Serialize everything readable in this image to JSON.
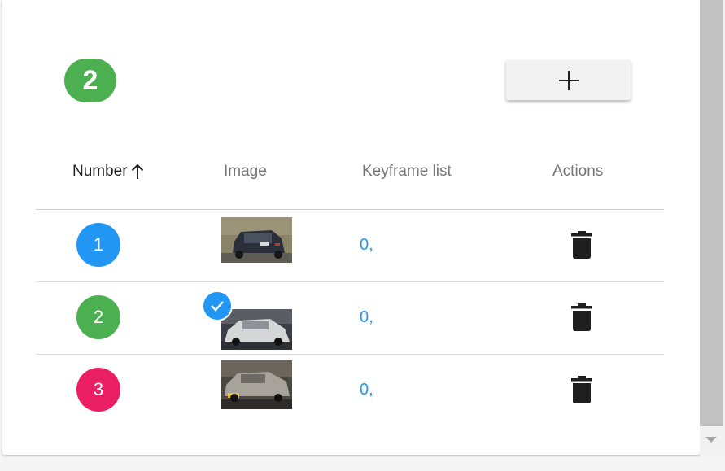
{
  "header": {
    "current_number": "2",
    "current_color": "#4caf50"
  },
  "toolbar": {
    "add_icon": "plus-icon"
  },
  "table": {
    "columns": {
      "number": "Number",
      "image": "Image",
      "keyframes": "Keyframe list",
      "actions": "Actions"
    },
    "sort_icon": "arrow-up-icon",
    "rows": [
      {
        "number": "1",
        "color": "#2196f3",
        "keyframes": "0,",
        "selected": false,
        "delete_icon": "trash-icon"
      },
      {
        "number": "2",
        "color": "#4caf50",
        "keyframes": "0,",
        "selected": true,
        "delete_icon": "trash-icon"
      },
      {
        "number": "3",
        "color": "#e91e63",
        "keyframes": "0,",
        "selected": false,
        "delete_icon": "trash-icon"
      }
    ]
  }
}
